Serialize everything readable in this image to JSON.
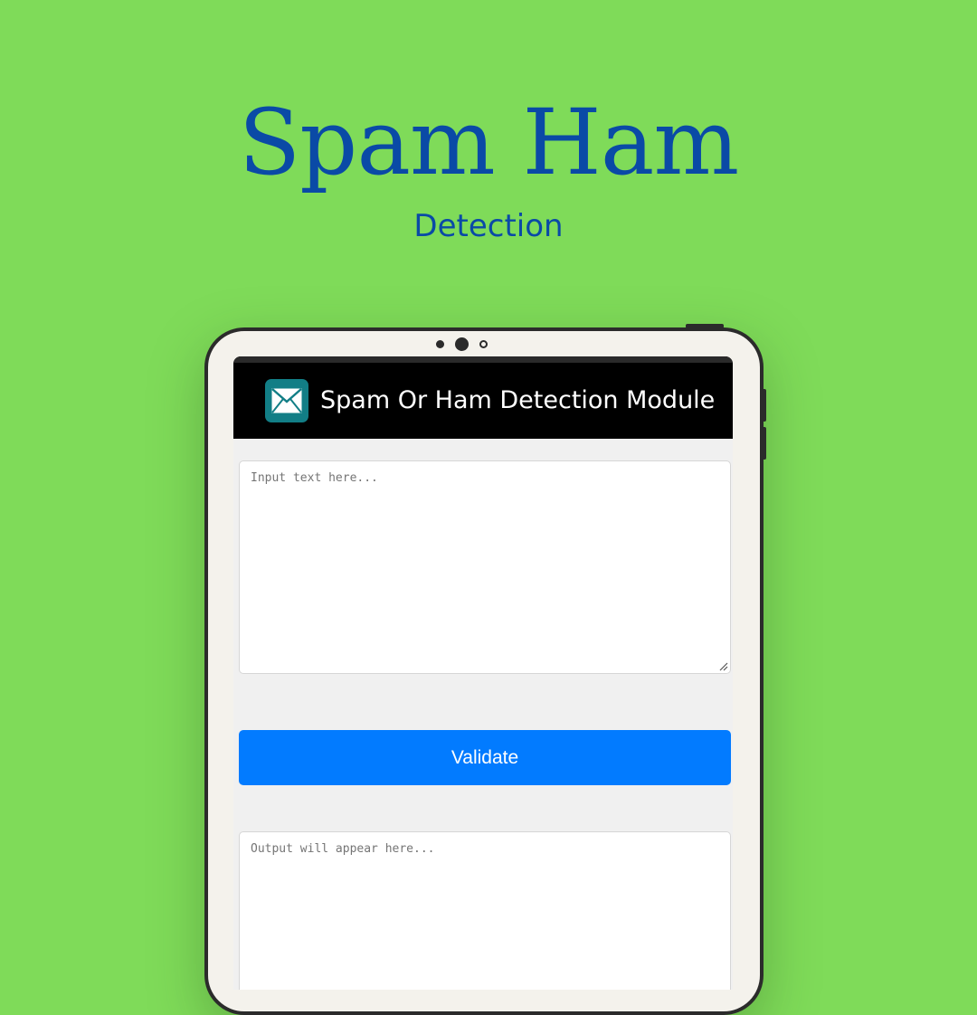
{
  "hero": {
    "title": "Spam Ham",
    "subtitle": "Detection"
  },
  "app": {
    "header_title": "Spam Or Ham Detection Module",
    "header_icon": "envelope-icon",
    "input_placeholder": "Input text here...",
    "input_value": "",
    "validate_label": "Validate",
    "output_placeholder": "Output will appear here...",
    "output_value": ""
  },
  "colors": {
    "page_background": "#7fdb59",
    "hero_text": "#0a4aa6",
    "header_background": "#000000",
    "icon_background": "#127e86",
    "button_background": "#027bff",
    "screen_background": "#f0f0f0",
    "device_frame": "#2b2b2b"
  }
}
